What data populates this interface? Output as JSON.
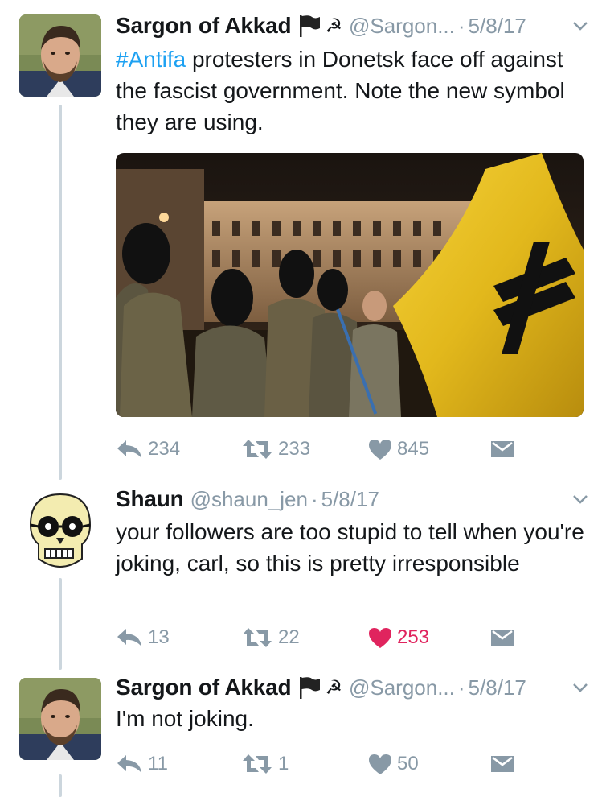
{
  "tweets": [
    {
      "name": "Sargon of Akkad",
      "handle": "@Sargon...",
      "date": "5/8/17",
      "name_symbols": [
        "black-flag-icon",
        "hammer-sickle-icon"
      ],
      "hashtag": "#Antifa",
      "text_rest": " protesters in Donetsk face off against the fascist government. Note the new symbol they are using.",
      "image": {
        "description_icon": "protest-photo-with-flag"
      },
      "reply_count": "234",
      "retweet_count": "233",
      "like_count": "845",
      "liked": false
    },
    {
      "name": "Shaun",
      "handle": "@shaun_jen",
      "date": "5/8/17",
      "text": "your followers are too stupid to tell when you're joking, carl, so this is pretty irresponsible",
      "reply_count": "13",
      "retweet_count": "22",
      "like_count": "253",
      "liked": true
    },
    {
      "name": "Sargon of Akkad",
      "handle": "@Sargon...",
      "date": "5/8/17",
      "name_symbols": [
        "black-flag-icon",
        "hammer-sickle-icon"
      ],
      "text": "I'm not joking.",
      "reply_count": "11",
      "retweet_count": "1",
      "like_count": "50",
      "liked": false
    }
  ],
  "colors": {
    "hashtag": "#1da1f2",
    "meta_gray": "#8899a6",
    "like_red": "#e0245e",
    "thread_line": "#ccd6dd"
  }
}
